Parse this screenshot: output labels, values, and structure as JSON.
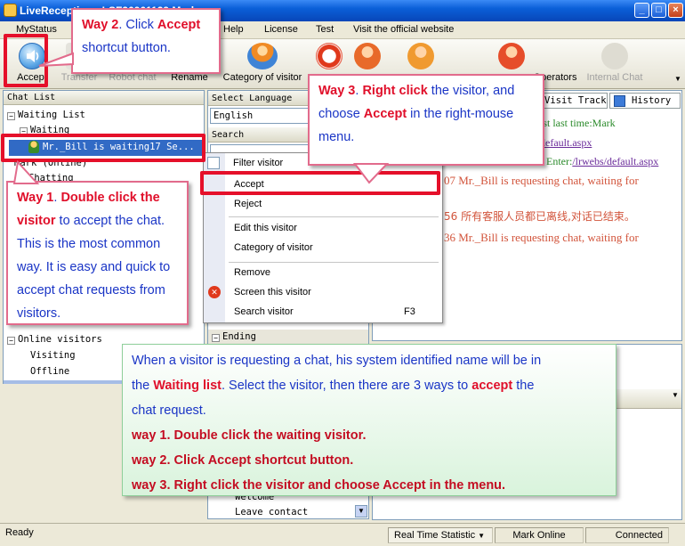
{
  "window": {
    "title": "LiveReception - LSF36961129 Mark"
  },
  "menu": [
    "MyStatus",
    "Help",
    "License",
    "Test",
    "Visit the official website"
  ],
  "toolbar": {
    "accept": "Accept",
    "transfer": "Transfer",
    "robot_chat": "Robot chat",
    "rename": "Rename",
    "category": "Category of visitor",
    "operators": "Operators",
    "internal_chat": "Internal Chat"
  },
  "chat_list": {
    "header": "Chat List",
    "waiting_list": "Waiting List",
    "waiting": "Waiting",
    "waiting_item": "Mr._Bill is waiting17 Se...",
    "mark_online": "Mark (Online)",
    "chatting": "Chatting",
    "online_visitors": "Online visitors",
    "visiting": "Visiting",
    "offline": "Offline"
  },
  "middle": {
    "select_language": "Select Language",
    "language_value": "English",
    "search": "Search",
    "filter_visitor": "Filter visitor",
    "ending": "Ending",
    "welcome": "Welcome",
    "leave_contact": "Leave contact"
  },
  "right_tabs": {
    "visit_track": "Visit Track",
    "history": "History"
  },
  "right_lines": {
    "l1": "uest last time:Mark",
    "l2": "s/default.aspx",
    "l3a": "07 Enter:",
    "l3b": "/lrwebs/default.aspx",
    "l4": "07  Mr._Bill is requesting chat, waiting for",
    "l5": "56  所有客服人员都已离线,对话已结束。",
    "l6": "36  Mr._Bill is requesting chat, waiting for"
  },
  "context_menu": {
    "accept": "Accept",
    "reject": "Reject",
    "edit": "Edit this visitor",
    "category": "Category of visitor",
    "remove": "Remove",
    "screen": "Screen this visitor",
    "search": "Search visitor",
    "search_shortcut": "F3"
  },
  "callouts": {
    "way2_prefix": "Way 2",
    "way2_action": ". Click ",
    "way2_accept": "Accept",
    "way2_rest": "shortcut button.",
    "way3_prefix": "Way 3",
    "way3_dot": ". ",
    "way3_rightclick": "Right click",
    "way3_text1": " the visitor, and",
    "way3_choose": "choose ",
    "way3_accept": "Accept",
    "way3_text2": " in the right-mouse",
    "way3_menu": "menu.",
    "way1_prefix": "Way 1",
    "way1_dot": ". ",
    "way1_dbl": "Double click the",
    "way1_visitor": "visitor",
    "way1_text1": " to accept the chat.",
    "way1_text2": "This is the most common",
    "way1_text3": "way.  It is easy and quick to",
    "way1_text4": "accept chat requests from",
    "way1_text5": "visitors."
  },
  "info": {
    "line1": "When a visitor is requesting a chat, his system identified name will be in",
    "line2_a": "the ",
    "line2_waiting": "Waiting list",
    "line2_b": ". Select the visitor, then there are 3 ways to ",
    "line2_accept": "accept",
    "line2_c": " the",
    "line3": "chat request.",
    "way1": "way 1. Double click the waiting visitor.",
    "way2": "way 2. Click Accept shortcut button.",
    "way3": "way 3. Right click the visitor and choose Accept  in the menu."
  },
  "status": {
    "ready": "Ready",
    "realtime": "Real Time Statistic",
    "mark_online": "Mark Online",
    "connected": "Connected"
  },
  "colors": {
    "highlight_red": "#e5102a",
    "callout_blue": "#1a35c6",
    "callout_border": "#e26b8c"
  }
}
